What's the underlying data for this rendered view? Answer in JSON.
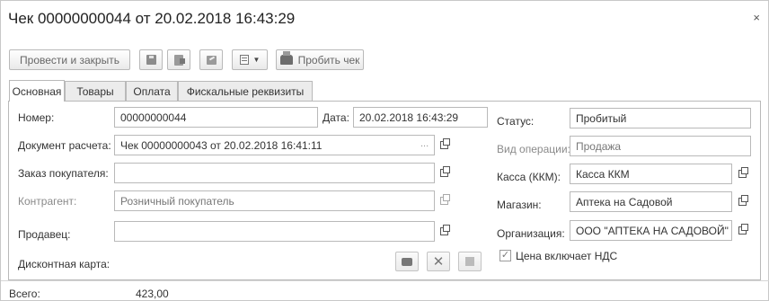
{
  "window": {
    "title": "Чек 00000000044 от 20.02.2018 16:43:29",
    "close_glyph": "×"
  },
  "toolbar": {
    "post_close_label": "Провести и закрыть",
    "print_receipt_label": "Пробить чек"
  },
  "tabs": [
    {
      "label": "Основная",
      "active": true
    },
    {
      "label": "Товары",
      "active": false
    },
    {
      "label": "Оплата",
      "active": false
    },
    {
      "label": "Фискальные реквизиты",
      "active": false
    }
  ],
  "form": {
    "number": {
      "label": "Номер:",
      "value": "00000000044"
    },
    "date": {
      "label": "Дата:",
      "value": "20.02.2018 16:43:29"
    },
    "payment_document": {
      "label": "Документ расчета:",
      "value": "Чек 00000000043 от 20.02.2018 16:41:11",
      "choose_glyph": "..."
    },
    "customer_order": {
      "label": "Заказ покупателя:",
      "value": ""
    },
    "counterparty": {
      "label": "Контрагент:",
      "value": "Розничный покупатель"
    },
    "seller": {
      "label": "Продавец:",
      "value": ""
    },
    "discount_card": {
      "label": "Дисконтная карта:"
    },
    "status": {
      "label": "Статус:",
      "value": "Пробитый"
    },
    "operation_type": {
      "label": "Вид операции:",
      "value": "Продажа"
    },
    "cash_register": {
      "label": "Касса (ККМ):",
      "value": "Касса ККМ"
    },
    "store": {
      "label": "Магазин:",
      "value": "Аптека на Садовой"
    },
    "organization": {
      "label": "Организация:",
      "value": "ООО \"АПТЕКА НА САДОВОЙ\""
    },
    "vat_included": {
      "label": "Цена включает НДС",
      "checked": true,
      "check_glyph": "✓"
    }
  },
  "footer": {
    "total_label": "Всего:",
    "total_value": "423,00"
  }
}
